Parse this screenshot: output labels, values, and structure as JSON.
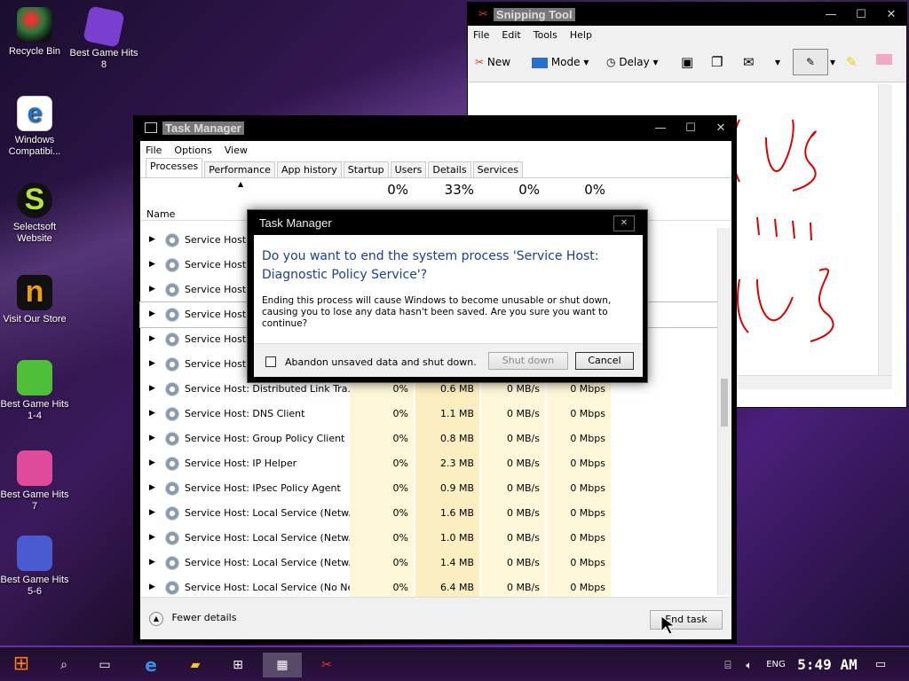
{
  "desktop": {
    "icons": [
      {
        "label": "Recycle Bin",
        "color": "#2d7a3a"
      },
      {
        "label": "Best Game Hits 8",
        "color": "#7a3fd0"
      },
      {
        "label": "Windows Compatibi...",
        "color": "#ffffff"
      },
      {
        "label": "Selectsoft Website",
        "color": "#b7e23a"
      },
      {
        "label": "Visit Our Store",
        "color": "#f0a000"
      },
      {
        "label": "Best Game Hits 1-4",
        "color": "#4fbf3a"
      },
      {
        "label": "Best Game Hits 7",
        "color": "#e04a9a"
      },
      {
        "label": "Best Game Hits 5-6",
        "color": "#4a5ad0"
      }
    ]
  },
  "snipping": {
    "title": "Snipping Tool",
    "menu": [
      "File",
      "Edit",
      "Tools",
      "Help"
    ],
    "toolbar": {
      "new": "New",
      "mode": "Mode",
      "delay": "Delay"
    }
  },
  "taskmgr": {
    "title": "Task Manager",
    "menu": [
      "File",
      "Options",
      "View"
    ],
    "tabs": [
      "Processes",
      "Performance",
      "App history",
      "Startup",
      "Users",
      "Details",
      "Services"
    ],
    "columns": {
      "name": "Name",
      "cpu": "0%",
      "memory": "33%",
      "disk": "0%",
      "network": "0%"
    },
    "rows": [
      {
        "name": "Service Host:",
        "cpu": "",
        "mem": "",
        "disk": "",
        "net": ""
      },
      {
        "name": "Service Host:",
        "cpu": "",
        "mem": "",
        "disk": "",
        "net": ""
      },
      {
        "name": "Service Host:",
        "cpu": "",
        "mem": "",
        "disk": "",
        "net": ""
      },
      {
        "name": "Service Host:",
        "cpu": "",
        "mem": "",
        "disk": "",
        "net": ""
      },
      {
        "name": "Service Host:",
        "cpu": "",
        "mem": "",
        "disk": "",
        "net": ""
      },
      {
        "name": "Service Host:",
        "cpu": "",
        "mem": "",
        "disk": "",
        "net": ""
      },
      {
        "name": "Service Host: Distributed Link Tra...",
        "cpu": "0%",
        "mem": "0.6 MB",
        "disk": "0 MB/s",
        "net": "0 Mbps"
      },
      {
        "name": "Service Host: DNS Client",
        "cpu": "0%",
        "mem": "1.1 MB",
        "disk": "0 MB/s",
        "net": "0 Mbps"
      },
      {
        "name": "Service Host: Group Policy Client",
        "cpu": "0%",
        "mem": "0.8 MB",
        "disk": "0 MB/s",
        "net": "0 Mbps"
      },
      {
        "name": "Service Host: IP Helper",
        "cpu": "0%",
        "mem": "2.3 MB",
        "disk": "0 MB/s",
        "net": "0 Mbps"
      },
      {
        "name": "Service Host: IPsec Policy Agent",
        "cpu": "0%",
        "mem": "0.9 MB",
        "disk": "0 MB/s",
        "net": "0 Mbps"
      },
      {
        "name": "Service Host: Local Service (Netw...",
        "cpu": "0%",
        "mem": "1.6 MB",
        "disk": "0 MB/s",
        "net": "0 Mbps"
      },
      {
        "name": "Service Host: Local Service (Netw...",
        "cpu": "0%",
        "mem": "1.0 MB",
        "disk": "0 MB/s",
        "net": "0 Mbps"
      },
      {
        "name": "Service Host: Local Service (Netw...",
        "cpu": "0%",
        "mem": "1.4 MB",
        "disk": "0 MB/s",
        "net": "0 Mbps"
      },
      {
        "name": "Service Host: Local Service (No Ne...",
        "cpu": "0%",
        "mem": "6.4 MB",
        "disk": "0 MB/s",
        "net": "0 Mbps"
      }
    ],
    "fewer_details": "Fewer details",
    "end_task": "End task"
  },
  "dialog": {
    "title": "Task Manager",
    "heading": "Do you want to end the system process 'Service Host: Diagnostic Policy Service'?",
    "body": "Ending this process will cause Windows to become unusable or shut down, causing you to lose any data hasn't been saved. Are you sure you want to continue?",
    "checkbox_label": "Abandon unsaved data and shut down.",
    "shutdown": "Shut down",
    "cancel": "Cancel",
    "close": "✕"
  },
  "taskbar": {
    "lang": "ENG",
    "clock": "5:49 AM"
  }
}
